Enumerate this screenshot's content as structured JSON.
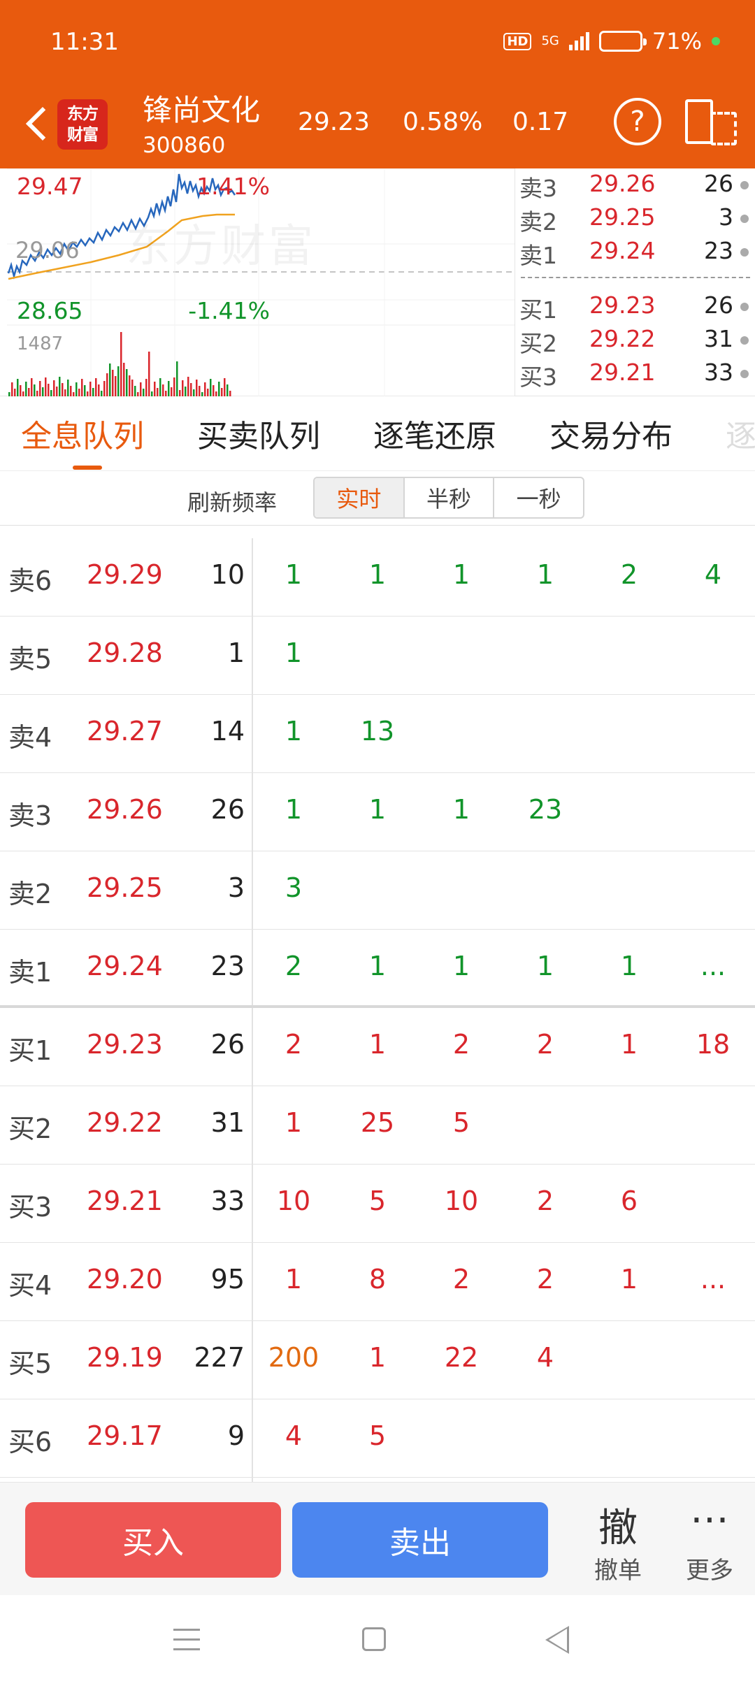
{
  "status_bar": {
    "time": "11:31",
    "hd": "HD",
    "network": "5G",
    "battery": "71%"
  },
  "stock": {
    "name": "锋尚文化",
    "code": "300860",
    "price": "29.23",
    "change_pct": "0.58%",
    "change": "0.17",
    "logo": [
      "东方",
      "财富"
    ]
  },
  "mini_chart": {
    "high": "29.47",
    "high_pct": "1.41%",
    "pre_close": "29.06",
    "low": "28.65",
    "low_pct": "-1.41%",
    "volume_max": "1487",
    "watermark": "东方财富"
  },
  "order_book": {
    "asks": [
      {
        "label": "卖3",
        "price": "29.26",
        "volume": "26"
      },
      {
        "label": "卖2",
        "price": "29.25",
        "volume": "3"
      },
      {
        "label": "卖1",
        "price": "29.24",
        "volume": "23"
      }
    ],
    "bids": [
      {
        "label": "买1",
        "price": "29.23",
        "volume": "26"
      },
      {
        "label": "买2",
        "price": "29.22",
        "volume": "31"
      },
      {
        "label": "买3",
        "price": "29.21",
        "volume": "33"
      }
    ]
  },
  "tabs": [
    "全息队列",
    "买卖队列",
    "逐笔还原",
    "交易分布",
    "逐"
  ],
  "refresh": {
    "label": "刷新频率",
    "options": [
      "实时",
      "半秒",
      "一秒"
    ],
    "active_index": 0
  },
  "queue": [
    {
      "label": "卖6",
      "price": "29.29",
      "volume": "10",
      "side": "ask",
      "orders": [
        "1",
        "1",
        "1",
        "1",
        "2",
        "4"
      ]
    },
    {
      "label": "卖5",
      "price": "29.28",
      "volume": "1",
      "side": "ask",
      "orders": [
        "1"
      ]
    },
    {
      "label": "卖4",
      "price": "29.27",
      "volume": "14",
      "side": "ask",
      "orders": [
        "1",
        "13"
      ]
    },
    {
      "label": "卖3",
      "price": "29.26",
      "volume": "26",
      "side": "ask",
      "orders": [
        "1",
        "1",
        "1",
        "23"
      ]
    },
    {
      "label": "卖2",
      "price": "29.25",
      "volume": "3",
      "side": "ask",
      "orders": [
        "3"
      ]
    },
    {
      "label": "卖1",
      "price": "29.24",
      "volume": "23",
      "side": "ask",
      "orders": [
        "2",
        "1",
        "1",
        "1",
        "1",
        "..."
      ]
    },
    {
      "label": "买1",
      "price": "29.23",
      "volume": "26",
      "side": "bid",
      "orders": [
        "2",
        "1",
        "2",
        "2",
        "1",
        "18"
      ]
    },
    {
      "label": "买2",
      "price": "29.22",
      "volume": "31",
      "side": "bid",
      "orders": [
        "1",
        "25",
        "5"
      ]
    },
    {
      "label": "买3",
      "price": "29.21",
      "volume": "33",
      "side": "bid",
      "orders": [
        "10",
        "5",
        "10",
        "2",
        "6"
      ]
    },
    {
      "label": "买4",
      "price": "29.20",
      "volume": "95",
      "side": "bid",
      "orders": [
        "1",
        "8",
        "2",
        "2",
        "1",
        "..."
      ]
    },
    {
      "label": "买5",
      "price": "29.19",
      "volume": "227",
      "side": "bid",
      "orders": [
        "200",
        "1",
        "22",
        "4"
      ],
      "highlight_index": 0
    },
    {
      "label": "买6",
      "price": "29.17",
      "volume": "9",
      "side": "bid",
      "orders": [
        "4",
        "5"
      ]
    }
  ],
  "actions": {
    "buy": "买入",
    "sell": "卖出",
    "cancel_icon": "撤",
    "cancel": "撤单",
    "more_icon": "⋯",
    "more": "更多"
  },
  "colors": {
    "brand": "#e85a0e",
    "up": "#d9262c",
    "down": "#11942a",
    "buy_btn": "#ee5654",
    "sell_btn": "#4c86ef"
  }
}
